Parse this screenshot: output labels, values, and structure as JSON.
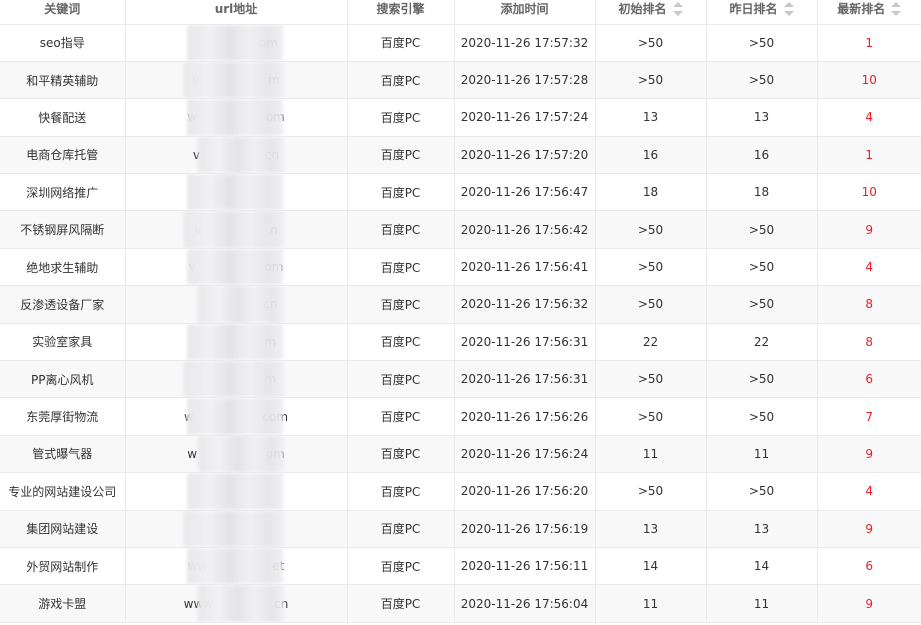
{
  "columns": {
    "keyword": "关键词",
    "url": "url地址",
    "engine": "搜索引擎",
    "added": "添加时间",
    "initial_rank": "初始排名",
    "yesterday_rank": "昨日排名",
    "latest_rank": "最新排名"
  },
  "rows": [
    {
      "keyword": "seo指导",
      "url": "                 om",
      "engine": "百度PC",
      "added": "2020-11-26 17:57:32",
      "initial": ">50",
      "yesterday": ">50",
      "latest": "1"
    },
    {
      "keyword": "和平精英辅助",
      "url": "v                  m",
      "engine": "百度PC",
      "added": "2020-11-26 17:57:28",
      "initial": ">50",
      "yesterday": ">50",
      "latest": "10"
    },
    {
      "keyword": "快餐配送",
      "url": "w                  om",
      "engine": "百度PC",
      "added": "2020-11-26 17:57:24",
      "initial": "13",
      "yesterday": "13",
      "latest": "4"
    },
    {
      "keyword": "电商仓库托管",
      "url": "v                 cn",
      "engine": "百度PC",
      "added": "2020-11-26 17:57:20",
      "initial": "16",
      "yesterday": "16",
      "latest": "1"
    },
    {
      "keyword": "深圳网络推广",
      "url": "",
      "engine": "百度PC",
      "added": "2020-11-26 17:56:47",
      "initial": "18",
      "yesterday": "18",
      "latest": "10"
    },
    {
      "keyword": "不锈钢屏风隔断",
      "url": "v                  n",
      "engine": "百度PC",
      "added": "2020-11-26 17:56:42",
      "initial": ">50",
      "yesterday": ">50",
      "latest": "9"
    },
    {
      "keyword": "绝地求生辅助",
      "url": "v                  om",
      "engine": "百度PC",
      "added": "2020-11-26 17:56:41",
      "initial": ">50",
      "yesterday": ">50",
      "latest": "4"
    },
    {
      "keyword": "反渗透设备厂家",
      "url": "                  cn",
      "engine": "百度PC",
      "added": "2020-11-26 17:56:32",
      "initial": ">50",
      "yesterday": ">50",
      "latest": "8"
    },
    {
      "keyword": "实验室家具",
      "url": "                  m",
      "engine": "百度PC",
      "added": "2020-11-26 17:56:31",
      "initial": "22",
      "yesterday": "22",
      "latest": "8"
    },
    {
      "keyword": "PP离心风机",
      "url": "                  m",
      "engine": "百度PC",
      "added": "2020-11-26 17:56:31",
      "initial": ">50",
      "yesterday": ">50",
      "latest": "6"
    },
    {
      "keyword": "东莞厚街物流",
      "url": "w                  com",
      "engine": "百度PC",
      "added": "2020-11-26 17:56:26",
      "initial": ">50",
      "yesterday": ">50",
      "latest": "7"
    },
    {
      "keyword": "管式曝气器",
      "url": "w                  om",
      "engine": "百度PC",
      "added": "2020-11-26 17:56:24",
      "initial": "11",
      "yesterday": "11",
      "latest": "9"
    },
    {
      "keyword": "专业的网站建设公司",
      "url": "",
      "engine": "百度PC",
      "added": "2020-11-26 17:56:20",
      "initial": ">50",
      "yesterday": ">50",
      "latest": "4"
    },
    {
      "keyword": "集团网站建设",
      "url": "",
      "engine": "百度PC",
      "added": "2020-11-26 17:56:19",
      "initial": "13",
      "yesterday": "13",
      "latest": "9"
    },
    {
      "keyword": "外贸网站制作",
      "url": "ww                 et",
      "engine": "百度PC",
      "added": "2020-11-26 17:56:11",
      "initial": "14",
      "yesterday": "14",
      "latest": "6"
    },
    {
      "keyword": "游戏卡盟",
      "url": "www                cn",
      "engine": "百度PC",
      "added": "2020-11-26 17:56:04",
      "initial": "11",
      "yesterday": "11",
      "latest": "9"
    }
  ],
  "colors": {
    "latest_rank": "#ed1c24",
    "header_text": "#666666",
    "zebra_row": "#f8f8f9",
    "border": "#e8eaec",
    "sort_icon": "#c5c8ce"
  }
}
